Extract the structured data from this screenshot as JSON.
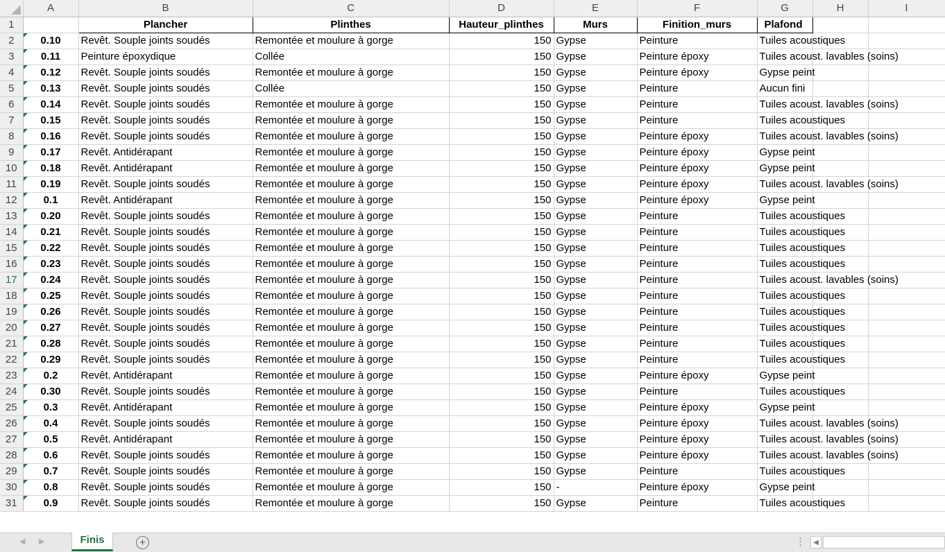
{
  "columns": [
    "A",
    "B",
    "C",
    "D",
    "E",
    "F",
    "G",
    "H",
    "I"
  ],
  "headers": {
    "B": "Plancher",
    "C": "Plinthes",
    "D": "Hauteur_plinthes",
    "E": "Murs",
    "F": "Finition_murs",
    "G": "Plafond"
  },
  "rows": [
    {
      "n": "2",
      "a": "0.10",
      "b": "Revêt. Souple joints soudés",
      "c": "Remontée et moulure à gorge",
      "d": "150",
      "e": "Gypse",
      "f": "Peinture",
      "g": "Tuiles acoustiques"
    },
    {
      "n": "3",
      "a": "0.11",
      "b": "Peinture époxydique",
      "c": "Collée",
      "d": "150",
      "e": "Gypse",
      "f": "Peinture époxy",
      "g": "Tuiles acoust. lavables (soins)"
    },
    {
      "n": "4",
      "a": "0.12",
      "b": "Revêt. Souple joints soudés",
      "c": "Remontée et moulure à gorge",
      "d": "150",
      "e": "Gypse",
      "f": "Peinture époxy",
      "g": "Gypse peint"
    },
    {
      "n": "5",
      "a": "0.13",
      "b": "Revêt. Souple joints soudés",
      "c": "Collée",
      "d": "150",
      "e": "Gypse",
      "f": "Peinture",
      "g": "Aucun fini"
    },
    {
      "n": "6",
      "a": "0.14",
      "b": "Revêt. Souple joints soudés",
      "c": "Remontée et moulure à gorge",
      "d": "150",
      "e": "Gypse",
      "f": "Peinture",
      "g": "Tuiles acoust. lavables (soins)"
    },
    {
      "n": "7",
      "a": "0.15",
      "b": "Revêt. Souple joints soudés",
      "c": "Remontée et moulure à gorge",
      "d": "150",
      "e": "Gypse",
      "f": "Peinture",
      "g": "Tuiles acoustiques"
    },
    {
      "n": "8",
      "a": "0.16",
      "b": "Revêt. Souple joints soudés",
      "c": "Remontée et moulure à gorge",
      "d": "150",
      "e": "Gypse",
      "f": "Peinture époxy",
      "g": "Tuiles acoust. lavables (soins)"
    },
    {
      "n": "9",
      "a": "0.17",
      "b": "Revêt. Antidérapant",
      "c": "Remontée et moulure à gorge",
      "d": "150",
      "e": "Gypse",
      "f": "Peinture époxy",
      "g": "Gypse peint"
    },
    {
      "n": "10",
      "a": "0.18",
      "b": "Revêt. Antidérapant",
      "c": "Remontée et moulure à gorge",
      "d": "150",
      "e": "Gypse",
      "f": "Peinture époxy",
      "g": "Gypse peint"
    },
    {
      "n": "11",
      "a": "0.19",
      "b": "Revêt. Souple joints soudés",
      "c": "Remontée et moulure à gorge",
      "d": "150",
      "e": "Gypse",
      "f": "Peinture époxy",
      "g": "Tuiles acoust. lavables (soins)"
    },
    {
      "n": "12",
      "a": "0.1",
      "b": "Revêt. Antidérapant",
      "c": "Remontée et moulure à gorge",
      "d": "150",
      "e": "Gypse",
      "f": "Peinture époxy",
      "g": "Gypse peint"
    },
    {
      "n": "13",
      "a": "0.20",
      "b": "Revêt. Souple joints soudés",
      "c": "Remontée et moulure à gorge",
      "d": "150",
      "e": "Gypse",
      "f": "Peinture",
      "g": "Tuiles acoustiques"
    },
    {
      "n": "14",
      "a": "0.21",
      "b": "Revêt. Souple joints soudés",
      "c": "Remontée et moulure à gorge",
      "d": "150",
      "e": "Gypse",
      "f": "Peinture",
      "g": "Tuiles acoustiques"
    },
    {
      "n": "15",
      "a": "0.22",
      "b": "Revêt. Souple joints soudés",
      "c": "Remontée et moulure à gorge",
      "d": "150",
      "e": "Gypse",
      "f": "Peinture",
      "g": "Tuiles acoustiques"
    },
    {
      "n": "16",
      "a": "0.23",
      "b": "Revêt. Souple joints soudés",
      "c": "Remontée et moulure à gorge",
      "d": "150",
      "e": "Gypse",
      "f": "Peinture",
      "g": "Tuiles acoustiques"
    },
    {
      "n": "17",
      "a": "0.24",
      "b": "Revêt. Souple joints soudés",
      "c": "Remontée et moulure à gorge",
      "d": "150",
      "e": "Gypse",
      "f": "Peinture",
      "g": "Tuiles acoust. lavables (soins)"
    },
    {
      "n": "18",
      "a": "0.25",
      "b": "Revêt. Souple joints soudés",
      "c": "Remontée et moulure à gorge",
      "d": "150",
      "e": "Gypse",
      "f": "Peinture",
      "g": "Tuiles acoustiques"
    },
    {
      "n": "19",
      "a": "0.26",
      "b": "Revêt. Souple joints soudés",
      "c": "Remontée et moulure à gorge",
      "d": "150",
      "e": "Gypse",
      "f": "Peinture",
      "g": "Tuiles acoustiques"
    },
    {
      "n": "20",
      "a": "0.27",
      "b": "Revêt. Souple joints soudés",
      "c": "Remontée et moulure à gorge",
      "d": "150",
      "e": "Gypse",
      "f": "Peinture",
      "g": "Tuiles acoustiques"
    },
    {
      "n": "21",
      "a": "0.28",
      "b": "Revêt. Souple joints soudés",
      "c": "Remontée et moulure à gorge",
      "d": "150",
      "e": "Gypse",
      "f": "Peinture",
      "g": "Tuiles acoustiques"
    },
    {
      "n": "22",
      "a": "0.29",
      "b": "Revêt. Souple joints soudés",
      "c": "Remontée et moulure à gorge",
      "d": "150",
      "e": "Gypse",
      "f": "Peinture",
      "g": "Tuiles acoustiques"
    },
    {
      "n": "23",
      "a": "0.2",
      "b": "Revêt. Antidérapant",
      "c": "Remontée et moulure à gorge",
      "d": "150",
      "e": "Gypse",
      "f": "Peinture époxy",
      "g": "Gypse peint"
    },
    {
      "n": "24",
      "a": "0.30",
      "b": "Revêt. Souple joints soudés",
      "c": "Remontée et moulure à gorge",
      "d": "150",
      "e": "Gypse",
      "f": "Peinture",
      "g": "Tuiles acoustiques"
    },
    {
      "n": "25",
      "a": "0.3",
      "b": "Revêt. Antidérapant",
      "c": "Remontée et moulure à gorge",
      "d": "150",
      "e": "Gypse",
      "f": "Peinture époxy",
      "g": "Gypse peint"
    },
    {
      "n": "26",
      "a": "0.4",
      "b": "Revêt. Souple joints soudés",
      "c": "Remontée et moulure à gorge",
      "d": "150",
      "e": "Gypse",
      "f": "Peinture époxy",
      "g": "Tuiles acoust. lavables (soins)"
    },
    {
      "n": "27",
      "a": "0.5",
      "b": "Revêt. Antidérapant",
      "c": "Remontée et moulure à gorge",
      "d": "150",
      "e": "Gypse",
      "f": "Peinture époxy",
      "g": "Tuiles acoust. lavables (soins)"
    },
    {
      "n": "28",
      "a": "0.6",
      "b": "Revêt. Souple joints soudés",
      "c": "Remontée et moulure à gorge",
      "d": "150",
      "e": "Gypse",
      "f": "Peinture époxy",
      "g": "Tuiles acoust. lavables (soins)"
    },
    {
      "n": "29",
      "a": "0.7",
      "b": "Revêt. Souple joints soudés",
      "c": "Remontée et moulure à gorge",
      "d": "150",
      "e": "Gypse",
      "f": "Peinture",
      "g": "Tuiles acoustiques"
    },
    {
      "n": "30",
      "a": "0.8",
      "b": "Revêt. Souple joints soudés",
      "c": "Remontée et moulure à gorge",
      "d": "150",
      "e": "-",
      "f": "Peinture époxy",
      "g": "Gypse peint"
    },
    {
      "n": "31",
      "a": "0.9",
      "b": "Revêt. Souple joints soudés",
      "c": "Remontée et moulure à gorge",
      "d": "150",
      "e": "Gypse",
      "f": "Peinture",
      "g": "Tuiles acoustiques"
    }
  ],
  "selected_row": "17",
  "sheet_tab": "Finis",
  "colors": {
    "accent": "#217346",
    "gridline": "#d4d4d4",
    "header_bg": "#efefef",
    "error_triangle": "#2e7d32"
  },
  "icons": {
    "add_sheet": "plus-circle-icon",
    "nav_prev": "triangle-left-icon",
    "nav_next": "triangle-right-icon"
  }
}
